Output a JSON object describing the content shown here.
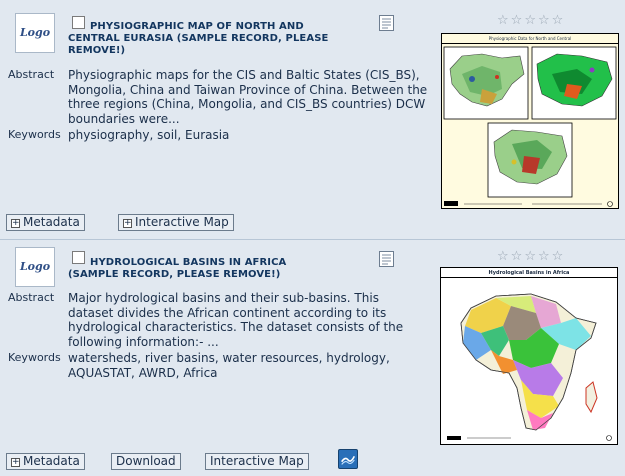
{
  "records": [
    {
      "logo": "Logo",
      "title_line1": "PHYSIOGRAPHIC MAP OF NORTH AND",
      "title_line2": "CENTRAL EURASIA (SAMPLE RECORD, PLEASE",
      "title_line3": "REMOVE!)",
      "abstract_label": "Abstract",
      "abstract_text": "Physiographic maps for the CIS and Baltic States (CIS_BS), Mongolia, China and Taiwan Province of China. Between the three regions (China, Mongolia, and CIS_BS countries) DCW boundaries were...",
      "keywords_label": "Keywords",
      "keywords_text": "physiography, soil, Eurasia",
      "thumbnail_caption": "Physiographic Data for North and Central",
      "rating_stars": 0,
      "buttons": {
        "metadata": "Metadata",
        "interactive_map": "Interactive Map"
      }
    },
    {
      "logo": "Logo",
      "title_line1": "HYDROLOGICAL BASINS IN AFRICA",
      "title_line2": "(SAMPLE RECORD, PLEASE REMOVE!)",
      "abstract_label": "Abstract",
      "abstract_text": "Major hydrological basins and their sub-basins. This dataset divides the African continent according to its hydrological characteristics. The dataset consists of the following information:- ...",
      "keywords_label": "Keywords",
      "keywords_text": "watersheds, river basins, water resources, hydrology, AQUASTAT, AWRD, Africa",
      "thumbnail_caption": "Hydrological Basins in Africa",
      "rating_stars": 0,
      "buttons": {
        "metadata": "Metadata",
        "download": "Download",
        "interactive_map": "Interactive Map"
      }
    }
  ]
}
